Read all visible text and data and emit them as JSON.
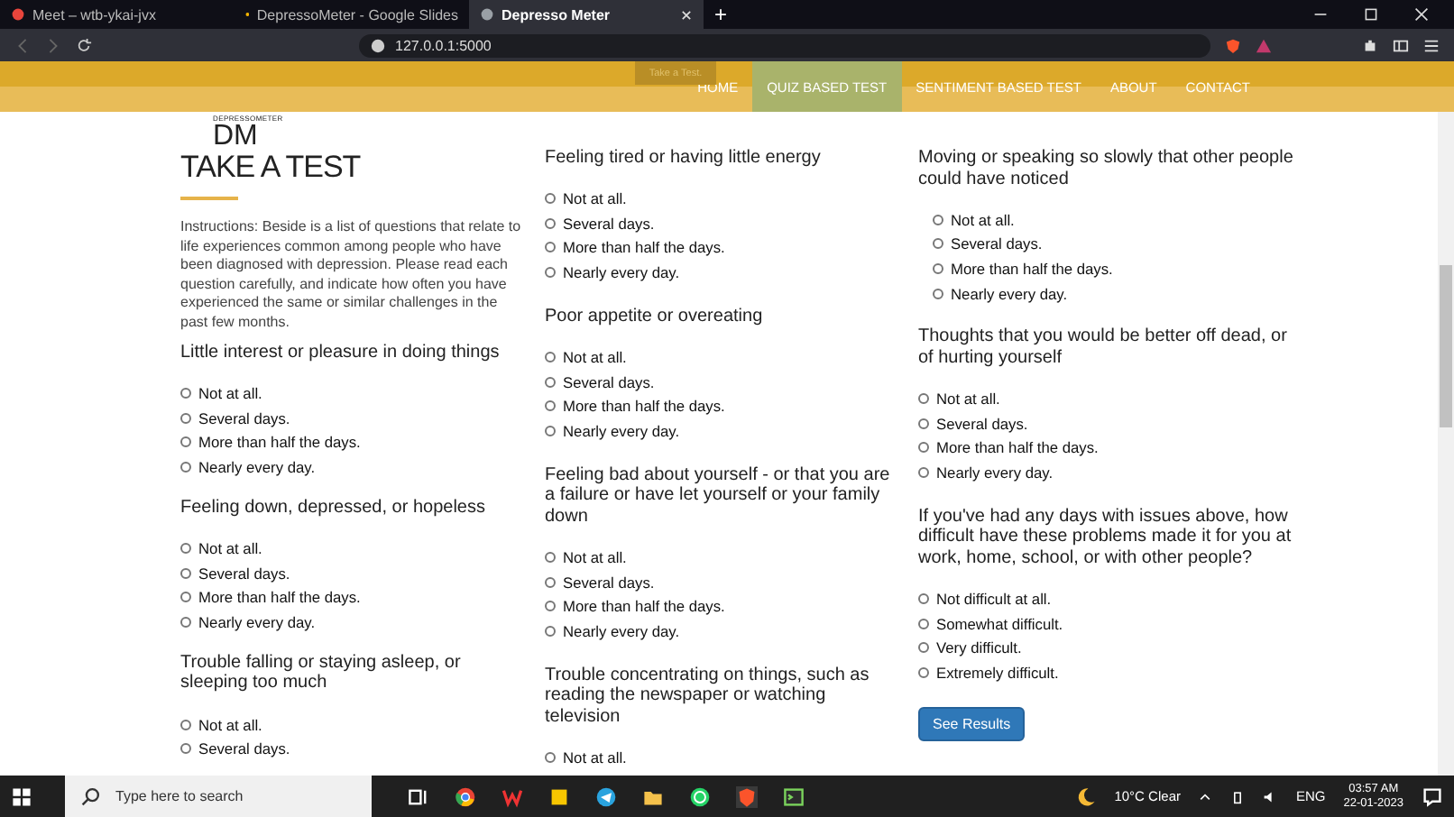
{
  "browser": {
    "tabs": [
      {
        "title": "Meet – wtb-ykai-jvx",
        "selected": false
      },
      {
        "title": "DepressoMeter - Google Slides",
        "selected": false
      },
      {
        "title": "Depresso Meter",
        "selected": true
      }
    ],
    "new_tab": "+",
    "address": "127.0.0.1:5000"
  },
  "navbar": {
    "logo": "DM",
    "logo_subtitle": "DEPRESSOMETER",
    "tooltip": "Take a Test.",
    "links": [
      {
        "label": "HOME",
        "selected": false
      },
      {
        "label": "QUIZ BASED TEST",
        "selected": true
      },
      {
        "label": "SENTIMENT BASED TEST",
        "selected": false
      },
      {
        "label": "ABOUT",
        "selected": false
      },
      {
        "label": "CONTACT",
        "selected": false
      }
    ]
  },
  "intro": {
    "title": "TAKE A TEST",
    "instructions": "Instructions: Beside is a list of questions that relate to life experiences common among people who have been diagnosed with depression. Please read each question carefully, and indicate how often you have experienced the same or similar challenges in the past few months."
  },
  "columns": [
    [
      {
        "text": "Little interest or pleasure in doing things",
        "options": [
          {
            "label": "Not at all.",
            "selected": false
          },
          {
            "label": "Several days.",
            "selected": false
          },
          {
            "label": "More than half the days.",
            "selected": false
          },
          {
            "label": "Nearly every day.",
            "selected": false
          }
        ]
      },
      {
        "text": "Feeling down, depressed, or hopeless",
        "options": [
          {
            "label": "Not at all.",
            "selected": false
          },
          {
            "label": "Several days.",
            "selected": false
          },
          {
            "label": "More than half the days.",
            "selected": false
          },
          {
            "label": "Nearly every day.",
            "selected": false
          }
        ]
      },
      {
        "text": "Trouble falling or staying asleep, or sleeping too much",
        "options": [
          {
            "label": "Not at all.",
            "selected": false
          },
          {
            "label": "Several days.",
            "selected": false
          }
        ]
      }
    ],
    [
      {
        "text": "Feeling tired or having little energy",
        "options": [
          {
            "label": "Not at all.",
            "selected": false
          },
          {
            "label": "Several days.",
            "selected": false
          },
          {
            "label": "More than half the days.",
            "selected": false
          },
          {
            "label": "Nearly every day.",
            "selected": false
          }
        ]
      },
      {
        "text": "Poor appetite or overeating",
        "options": [
          {
            "label": "Not at all.",
            "selected": false
          },
          {
            "label": "Several days.",
            "selected": false
          },
          {
            "label": "More than half the days.",
            "selected": false
          },
          {
            "label": "Nearly every day.",
            "selected": false
          }
        ]
      },
      {
        "text": "Feeling bad about yourself - or that you are a failure or have let yourself or your family down",
        "options": [
          {
            "label": "Not at all.",
            "selected": false
          },
          {
            "label": "Several days.",
            "selected": false
          },
          {
            "label": "More than half the days.",
            "selected": false
          },
          {
            "label": "Nearly every day.",
            "selected": false
          }
        ]
      },
      {
        "text": "Trouble concentrating on things, such as reading the newspaper or watching television",
        "options": [
          {
            "label": "Not at all.",
            "selected": false
          }
        ]
      }
    ],
    [
      {
        "text": "Moving or speaking so slowly that other people could have noticed",
        "options": [
          {
            "label": "Not at all.",
            "selected": false
          },
          {
            "label": "Several days.",
            "selected": false
          },
          {
            "label": "More than half the days.",
            "selected": false
          },
          {
            "label": "Nearly every day.",
            "selected": false
          }
        ]
      },
      {
        "text": "Thoughts that you would be better off dead, or of hurting yourself",
        "options": [
          {
            "label": "Not at all.",
            "selected": false
          },
          {
            "label": "Several days.",
            "selected": false
          },
          {
            "label": "More than half the days.",
            "selected": false
          },
          {
            "label": "Nearly every day.",
            "selected": false
          }
        ]
      },
      {
        "text": "If you've had any days with issues above, how difficult have these problems made it for you at work, home, school, or with other people?",
        "options": [
          {
            "label": "Not difficult at all.",
            "selected": false
          },
          {
            "label": "Somewhat difficult.",
            "selected": false
          },
          {
            "label": "Very difficult.",
            "selected": false
          },
          {
            "label": "Extremely difficult.",
            "selected": false
          }
        ]
      }
    ]
  ],
  "submit_button": "See Results",
  "taskbar": {
    "search_placeholder": "Type here to search",
    "weather": "10°C  Clear",
    "language": "ENG",
    "time": "03:57 AM",
    "date": "22-01-2023"
  }
}
